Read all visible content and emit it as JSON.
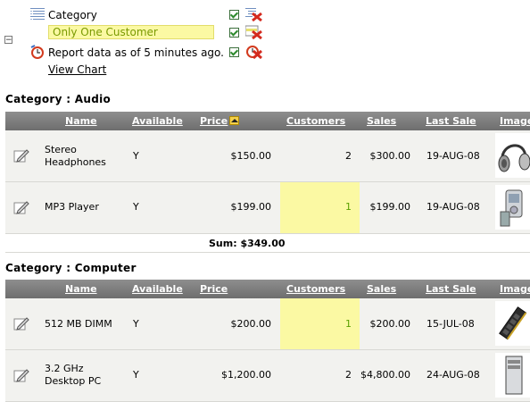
{
  "controls": {
    "toggle_symbol": "⊟",
    "category_label": "Category",
    "highlight_label": "Only One Customer",
    "report_note": "Report data as of 5 minutes ago.",
    "view_chart": "View Chart"
  },
  "columns": [
    "Name",
    "Available",
    "Price",
    "Customers",
    "Sales",
    "Last Sale",
    "Image"
  ],
  "groups": [
    {
      "title": "Category : Audio",
      "rows": [
        {
          "name_line1": "Stereo",
          "name_line2": "Headphones",
          "available": "Y",
          "price": "$150.00",
          "customers": "2",
          "sales": "$300.00",
          "last_sale": "19-AUG-08",
          "image": "headphones-image",
          "highlight": false
        },
        {
          "name_line1": "MP3 Player",
          "name_line2": "",
          "available": "Y",
          "price": "$199.00",
          "customers": "1",
          "sales": "$199.00",
          "last_sale": "19-AUG-08",
          "image": "mp3-player-image",
          "highlight": true
        }
      ],
      "sum": "Sum: $349.00"
    },
    {
      "title": "Category : Computer",
      "rows": [
        {
          "name_line1": "512 MB DIMM",
          "name_line2": "",
          "available": "Y",
          "price": "$200.00",
          "customers": "1",
          "sales": "$200.00",
          "last_sale": "15-JUL-08",
          "image": "memory-module-image",
          "highlight": true
        },
        {
          "name_line1": "3.2 GHz",
          "name_line2": "Desktop PC",
          "available": "Y",
          "price": "$1,200.00",
          "customers": "2",
          "sales": "$4,800.00",
          "last_sale": "24-AUG-08",
          "image": "desktop-pc-image",
          "highlight": false
        }
      ]
    }
  ],
  "colors": {
    "header": "#7d7d7d",
    "row": "#f2f2ef",
    "highlight": "#fbf9a3",
    "highlight_text": "#5aa000"
  }
}
